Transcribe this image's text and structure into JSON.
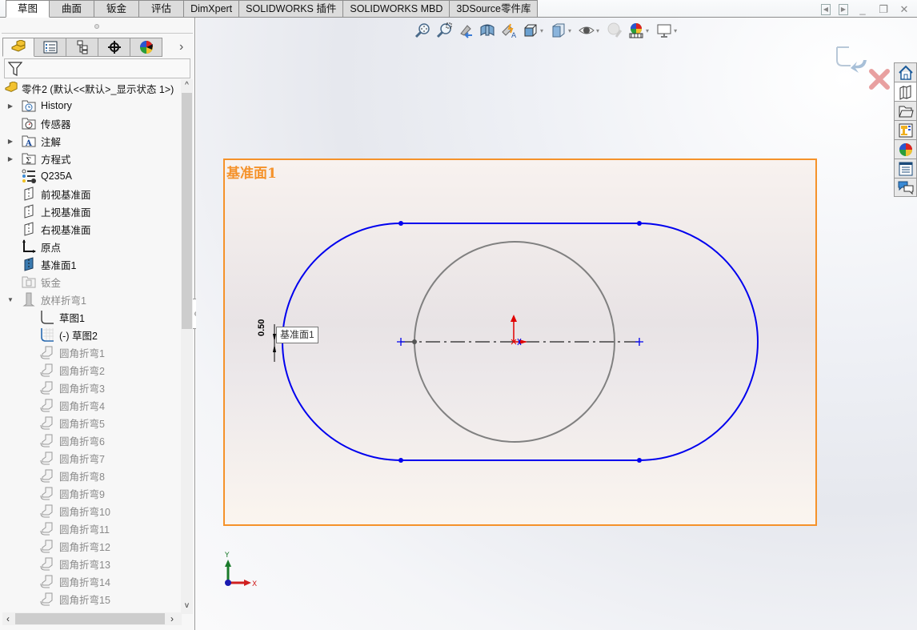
{
  "tabs": [
    {
      "label": "草图",
      "active": true
    },
    {
      "label": "曲面"
    },
    {
      "label": "钣金"
    },
    {
      "label": "评估"
    },
    {
      "label": "DimXpert"
    },
    {
      "label": "SOLIDWORKS 插件"
    },
    {
      "label": "SOLIDWORKS MBD"
    },
    {
      "label": "3DSource零件库"
    }
  ],
  "window_controls": [
    "panel-left-icon",
    "panel-right-icon",
    "minimize-icon",
    "restore-icon",
    "close-icon"
  ],
  "manager_tabs": [
    "featuremanager-icon",
    "propertymanager-icon",
    "configurationmanager-icon",
    "dimxpert-icon",
    "display-manager-icon"
  ],
  "tree": {
    "root": "零件2 (默认<<默认>_显示状态 1>)",
    "items": [
      {
        "label": "History",
        "icon": "history-folder-icon",
        "expandable": true,
        "level": 0
      },
      {
        "label": "传感器",
        "icon": "sensor-folder-icon",
        "level": 0
      },
      {
        "label": "注解",
        "icon": "annotation-folder-icon",
        "expandable": true,
        "level": 0
      },
      {
        "label": "方程式",
        "icon": "equation-folder-icon",
        "expandable": true,
        "level": 0
      },
      {
        "label": "Q235A",
        "icon": "material-icon",
        "level": 0
      },
      {
        "label": "前视基准面",
        "icon": "plane-icon",
        "level": 0
      },
      {
        "label": "上视基准面",
        "icon": "plane-icon",
        "level": 0
      },
      {
        "label": "右视基准面",
        "icon": "plane-icon",
        "level": 0
      },
      {
        "label": "原点",
        "icon": "origin-icon",
        "level": 0
      },
      {
        "label": "基准面1",
        "icon": "plane-selected-icon",
        "level": 0
      },
      {
        "label": "钣金",
        "icon": "sheetmetal-icon",
        "level": 0,
        "dim": true
      },
      {
        "label": "放样折弯1",
        "icon": "lofted-bend-icon",
        "expanded": true,
        "level": 0,
        "dim": true
      },
      {
        "label": "草图1",
        "icon": "sketch-icon",
        "level": 1
      },
      {
        "label": "(-) 草图2",
        "icon": "sketch-active-icon",
        "level": 1
      },
      {
        "label": "圆角折弯1",
        "icon": "bend-icon",
        "level": 1,
        "dim": true
      },
      {
        "label": "圆角折弯2",
        "icon": "bend-icon",
        "level": 1,
        "dim": true
      },
      {
        "label": "圆角折弯3",
        "icon": "bend-icon",
        "level": 1,
        "dim": true
      },
      {
        "label": "圆角折弯4",
        "icon": "bend-icon",
        "level": 1,
        "dim": true
      },
      {
        "label": "圆角折弯5",
        "icon": "bend-icon",
        "level": 1,
        "dim": true
      },
      {
        "label": "圆角折弯6",
        "icon": "bend-icon",
        "level": 1,
        "dim": true
      },
      {
        "label": "圆角折弯7",
        "icon": "bend-icon",
        "level": 1,
        "dim": true
      },
      {
        "label": "圆角折弯8",
        "icon": "bend-icon",
        "level": 1,
        "dim": true
      },
      {
        "label": "圆角折弯9",
        "icon": "bend-icon",
        "level": 1,
        "dim": true
      },
      {
        "label": "圆角折弯10",
        "icon": "bend-icon",
        "level": 1,
        "dim": true
      },
      {
        "label": "圆角折弯11",
        "icon": "bend-icon",
        "level": 1,
        "dim": true
      },
      {
        "label": "圆角折弯12",
        "icon": "bend-icon",
        "level": 1,
        "dim": true
      },
      {
        "label": "圆角折弯13",
        "icon": "bend-icon",
        "level": 1,
        "dim": true
      },
      {
        "label": "圆角折弯14",
        "icon": "bend-icon",
        "level": 1,
        "dim": true
      },
      {
        "label": "圆角折弯15",
        "icon": "bend-icon",
        "level": 1,
        "dim": true
      }
    ]
  },
  "heads_up_toolbar": [
    "zoom-to-fit-icon",
    "zoom-to-area-icon",
    "previous-view-icon",
    "section-view-icon",
    "dynamic-annotation-icon",
    "view-orientation-icon",
    "display-style-icon",
    "hide-show-items-icon",
    "edit-appearance-icon",
    "apply-scene-icon",
    "view-settings-icon"
  ],
  "task_pane": [
    "home-icon",
    "design-library-icon",
    "file-explorer-icon",
    "view-palette-icon",
    "appearances-icon",
    "custom-properties-icon",
    "forum-icon"
  ],
  "viewport": {
    "plane_label": "基准面1",
    "tooltip": "基准面1",
    "dimension_value": "0.50",
    "triad": {
      "x": "X",
      "y": "Y"
    }
  },
  "colors": {
    "sketch_line": "#0000ee",
    "construction_circle": "#808080",
    "plane_border": "#f5922a",
    "origin": "#e00000"
  }
}
